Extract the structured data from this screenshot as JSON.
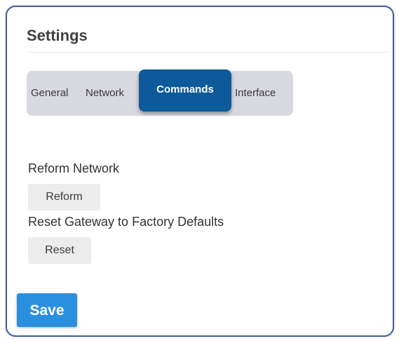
{
  "settings": {
    "title": "Settings"
  },
  "tabs": [
    {
      "label": "General",
      "active": false
    },
    {
      "label": "Network",
      "active": false
    },
    {
      "label": "Commands",
      "active": true
    },
    {
      "label": "Interface",
      "active": false
    }
  ],
  "commands": {
    "reform": {
      "label": "Reform Network",
      "button": "Reform"
    },
    "reset": {
      "label": "Reset Gateway to Factory Defaults",
      "button": "Reset"
    }
  },
  "footer": {
    "save_label": "Save"
  },
  "colors": {
    "accent": "#2b8fe0",
    "active_tab": "#0d5a9a",
    "tab_bar": "#d8d8e0",
    "border": "#3f5f9f"
  }
}
